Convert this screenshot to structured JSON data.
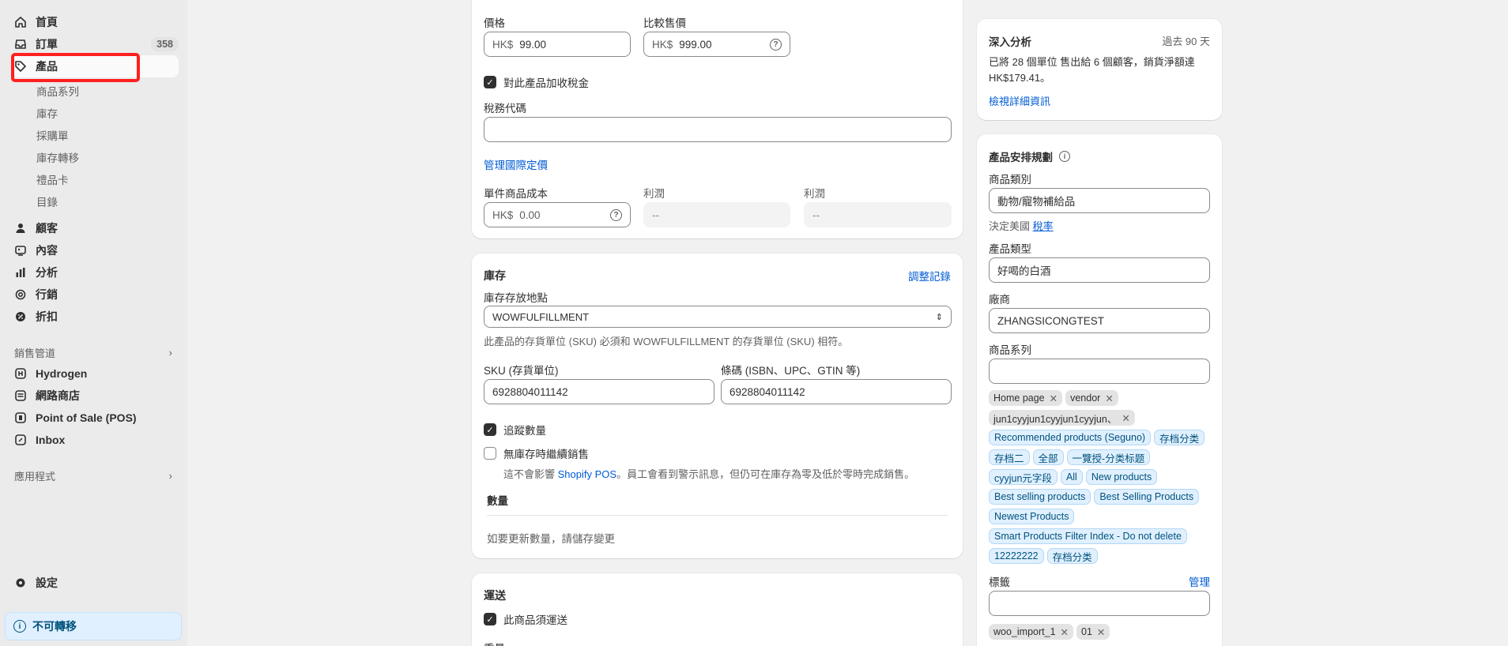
{
  "sidebar": {
    "items": [
      {
        "label": "首頁",
        "icon": "home-icon"
      },
      {
        "label": "訂單",
        "icon": "inbox-icon",
        "badge": "358"
      },
      {
        "label": "產品",
        "icon": "tag-icon"
      },
      {
        "label": "顧客",
        "icon": "person-icon"
      },
      {
        "label": "內容",
        "icon": "image-icon"
      },
      {
        "label": "分析",
        "icon": "bar-chart-icon"
      },
      {
        "label": "行銷",
        "icon": "target-icon"
      },
      {
        "label": "折扣",
        "icon": "discount-icon"
      }
    ],
    "product_subitems": [
      "商品系列",
      "庫存",
      "採購單",
      "庫存轉移",
      "禮品卡",
      "目錄"
    ],
    "sales_channels_title": "銷售管道",
    "sales_channels": [
      {
        "label": "Hydrogen",
        "icon": "hydrogen-icon"
      },
      {
        "label": "網路商店",
        "icon": "store-icon"
      },
      {
        "label": "Point of Sale (POS)",
        "icon": "pos-icon"
      },
      {
        "label": "Inbox",
        "icon": "inbox-chat-icon"
      }
    ],
    "apps_title": "應用程式",
    "settings_label": "設定",
    "nontransferable_label": "不可轉移"
  },
  "pricing": {
    "price_label": "價格",
    "price_prefix": "HK$",
    "price_value": "99.00",
    "compare_label": "比較售價",
    "compare_prefix": "HK$",
    "compare_value": "999.00",
    "charge_tax_label": "對此產品加收稅金",
    "tax_code_label": "稅務代碼",
    "tax_code_value": "",
    "intl_pricing_link": "管理國際定價",
    "cost_label": "單件商品成本",
    "cost_prefix": "HK$",
    "cost_placeholder": "0.00",
    "profit_label": "利潤",
    "profit_value": "--",
    "margin_label": "利潤",
    "margin_value": "--"
  },
  "inventory": {
    "title": "庫存",
    "adjust_link": "調整記錄",
    "location_label": "庫存存放地點",
    "location_value": "WOWFULFILLMENT",
    "location_note": "此產品的存貨單位 (SKU) 必須和 WOWFULFILLMENT 的存貨單位 (SKU) 相符。",
    "sku_label": "SKU (存貨單位)",
    "sku_value": "6928804011142",
    "barcode_label": "條碼 (ISBN、UPC、GTIN 等)",
    "barcode_value": "6928804011142",
    "track_label": "追蹤數量",
    "continue_label": "無庫存時繼續銷售",
    "continue_note_prefix": "這不會影響 ",
    "continue_note_link": "Shopify POS",
    "continue_note_suffix": "。員工會看到警示訊息，但仍可在庫存為零及低於零時完成銷售。",
    "quantity_title": "數量",
    "quantity_note": "如要更新數量，請儲存變更"
  },
  "shipping": {
    "title": "運送",
    "physical_label": "此商品須運送",
    "weight_label": "重量"
  },
  "insights": {
    "title": "深入分析",
    "period": "過去 90 天",
    "summary": "已將 28 個單位 售出給 6 個顧客，銷貨淨額達 HK$179.41。",
    "details_link": "檢視詳細資訊"
  },
  "organization": {
    "title": "產品安排規劃",
    "category_label": "商品類別",
    "category_value": "動物/寵物補給品",
    "tax_note_prefix": "決定美國",
    "tax_note_link": "稅率",
    "type_label": "產品類型",
    "type_value": "好喝的白酒",
    "vendor_label": "廠商",
    "vendor_value": "ZHANGSICONGTEST",
    "collections_label": "商品系列",
    "collection_tags_removable": [
      "Home page",
      "vendor",
      "jun1cyyjun1cyyjun1cyyjun、"
    ],
    "collection_tags_auto": [
      "Recommended products (Seguno)",
      "存档分类",
      "存档二",
      "全部",
      "一覽授-分类标题",
      "cyyjun元字段",
      "All",
      "New products",
      "Best selling products",
      "Best Selling Products",
      "Newest Products",
      "Smart Products Filter Index - Do not delete",
      "12222222",
      "存档分类"
    ],
    "tags_label": "標籤",
    "tags_manage": "管理",
    "tags": [
      "woo_import_1",
      "01"
    ]
  }
}
